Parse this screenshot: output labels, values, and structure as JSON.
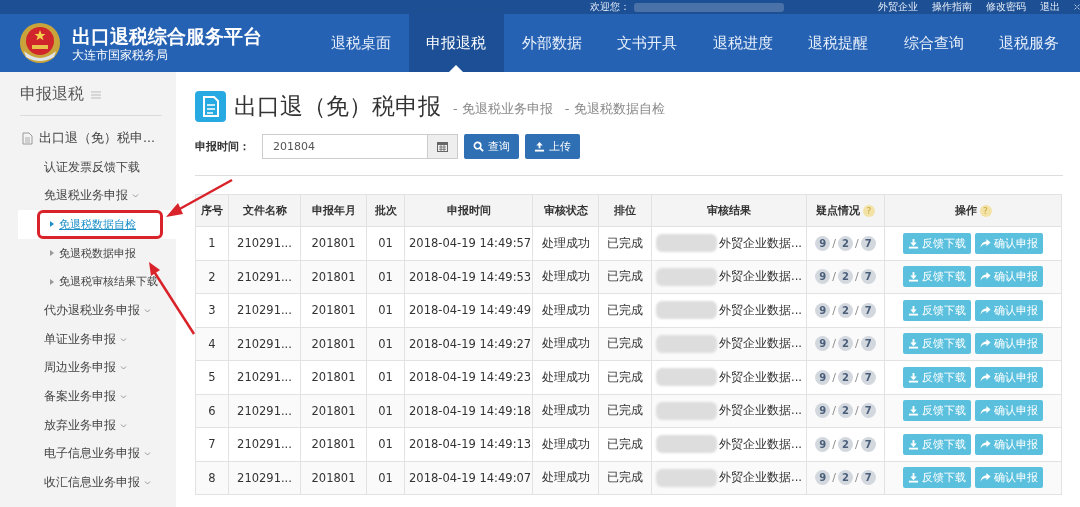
{
  "top_bar": {
    "welcome": "欢迎您：",
    "links": [
      "外贸企业",
      "操作指南",
      "修改密码",
      "退出"
    ]
  },
  "header": {
    "title": "出口退税综合服务平台",
    "subtitle": "大连市国家税务局"
  },
  "nav": [
    {
      "label": "退税桌面",
      "selected": false
    },
    {
      "label": "申报退税",
      "selected": true
    },
    {
      "label": "外部数据",
      "selected": false
    },
    {
      "label": "文书开具",
      "selected": false
    },
    {
      "label": "退税进度",
      "selected": false
    },
    {
      "label": "退税提醒",
      "selected": false
    },
    {
      "label": "综合查询",
      "selected": false
    },
    {
      "label": "退税服务",
      "selected": false
    }
  ],
  "sidebar": {
    "title": "申报退税",
    "items": [
      {
        "kind": "section",
        "label": "出口退（免）税申...",
        "selected": false,
        "children": [
          {
            "kind": "link",
            "label": "认证发票反馈下载",
            "selected": false
          },
          {
            "kind": "menu",
            "label": "免退税业务申报",
            "selected": false,
            "children": [
              {
                "kind": "leaf",
                "label": "免退税数据自检",
                "selected": true,
                "annotated": true
              },
              {
                "kind": "leaf",
                "label": "免退税数据申报",
                "selected": false,
                "annotated": false
              },
              {
                "kind": "leaf",
                "label": "免退税审核结果下载",
                "selected": false,
                "annotated": false
              }
            ]
          },
          {
            "kind": "menu",
            "label": "代办退税业务申报",
            "selected": false
          },
          {
            "kind": "menu",
            "label": "单证业务申报",
            "selected": false
          },
          {
            "kind": "menu",
            "label": "周边业务申报",
            "selected": false
          },
          {
            "kind": "menu",
            "label": "备案业务申报",
            "selected": false
          },
          {
            "kind": "menu",
            "label": "放弃业务申报",
            "selected": false
          },
          {
            "kind": "menu",
            "label": "电子信息业务申报",
            "selected": false
          },
          {
            "kind": "menu",
            "label": "收汇信息业务申报",
            "selected": false
          }
        ]
      }
    ]
  },
  "page": {
    "title": "出口退（免）税申报",
    "breadcrumbs": [
      "- 免退税业务申报",
      "- 免退税数据自检"
    ]
  },
  "search": {
    "label": "申报时间：",
    "value": "201804",
    "buttons": [
      {
        "kind": "search",
        "label": "查询"
      },
      {
        "kind": "upload",
        "label": "上传"
      }
    ]
  },
  "table": {
    "columns": [
      {
        "label": "序号"
      },
      {
        "label": "文件名称"
      },
      {
        "label": "申报年月"
      },
      {
        "label": "批次"
      },
      {
        "label": "申报时间"
      },
      {
        "label": "审核状态"
      },
      {
        "label": "排位"
      },
      {
        "label": "审核结果"
      },
      {
        "label": "疑点情况",
        "help": "?"
      },
      {
        "label": "操作",
        "help": "?"
      }
    ],
    "rows": [
      {
        "no": "1",
        "file": "210291...",
        "month": "201801",
        "batch": "01",
        "time": "2018-04-19 14:49:57",
        "status": "处理成功",
        "rank": "已完成",
        "result": "外贸企业数据...",
        "doubts": [
          {
            "kind": "count",
            "text": "9"
          },
          {
            "kind": "sep",
            "text": "/"
          },
          {
            "kind": "count",
            "text": "2"
          },
          {
            "kind": "sep",
            "text": "/"
          },
          {
            "kind": "count",
            "text": "7"
          }
        ],
        "actions": [
          {
            "kind": "download",
            "label": "反馈下载"
          },
          {
            "kind": "share",
            "label": "确认申报"
          }
        ]
      },
      {
        "no": "2",
        "file": "210291...",
        "month": "201801",
        "batch": "01",
        "time": "2018-04-19 14:49:53",
        "status": "处理成功",
        "rank": "已完成",
        "result": "外贸企业数据...",
        "doubts": [
          {
            "kind": "count",
            "text": "9"
          },
          {
            "kind": "sep",
            "text": "/"
          },
          {
            "kind": "count",
            "text": "2"
          },
          {
            "kind": "sep",
            "text": "/"
          },
          {
            "kind": "count",
            "text": "7"
          }
        ],
        "actions": [
          {
            "kind": "download",
            "label": "反馈下载"
          },
          {
            "kind": "share",
            "label": "确认申报"
          }
        ]
      },
      {
        "no": "3",
        "file": "210291...",
        "month": "201801",
        "batch": "01",
        "time": "2018-04-19 14:49:49",
        "status": "处理成功",
        "rank": "已完成",
        "result": "外贸企业数据...",
        "doubts": [
          {
            "kind": "count",
            "text": "9"
          },
          {
            "kind": "sep",
            "text": "/"
          },
          {
            "kind": "count",
            "text": "2"
          },
          {
            "kind": "sep",
            "text": "/"
          },
          {
            "kind": "count",
            "text": "7"
          }
        ],
        "actions": [
          {
            "kind": "download",
            "label": "反馈下载"
          },
          {
            "kind": "share",
            "label": "确认申报"
          }
        ]
      },
      {
        "no": "4",
        "file": "210291...",
        "month": "201801",
        "batch": "01",
        "time": "2018-04-19 14:49:27",
        "status": "处理成功",
        "rank": "已完成",
        "result": "外贸企业数据...",
        "doubts": [
          {
            "kind": "count",
            "text": "9"
          },
          {
            "kind": "sep",
            "text": "/"
          },
          {
            "kind": "count",
            "text": "2"
          },
          {
            "kind": "sep",
            "text": "/"
          },
          {
            "kind": "count",
            "text": "7"
          }
        ],
        "actions": [
          {
            "kind": "download",
            "label": "反馈下载"
          },
          {
            "kind": "share",
            "label": "确认申报"
          }
        ]
      },
      {
        "no": "5",
        "file": "210291...",
        "month": "201801",
        "batch": "01",
        "time": "2018-04-19 14:49:23",
        "status": "处理成功",
        "rank": "已完成",
        "result": "外贸企业数据...",
        "doubts": [
          {
            "kind": "count",
            "text": "9"
          },
          {
            "kind": "sep",
            "text": "/"
          },
          {
            "kind": "count",
            "text": "2"
          },
          {
            "kind": "sep",
            "text": "/"
          },
          {
            "kind": "count",
            "text": "7"
          }
        ],
        "actions": [
          {
            "kind": "download",
            "label": "反馈下载"
          },
          {
            "kind": "share",
            "label": "确认申报"
          }
        ]
      },
      {
        "no": "6",
        "file": "210291...",
        "month": "201801",
        "batch": "01",
        "time": "2018-04-19 14:49:18",
        "status": "处理成功",
        "rank": "已完成",
        "result": "外贸企业数据...",
        "doubts": [
          {
            "kind": "count",
            "text": "9"
          },
          {
            "kind": "sep",
            "text": "/"
          },
          {
            "kind": "count",
            "text": "2"
          },
          {
            "kind": "sep",
            "text": "/"
          },
          {
            "kind": "count",
            "text": "7"
          }
        ],
        "actions": [
          {
            "kind": "download",
            "label": "反馈下载"
          },
          {
            "kind": "share",
            "label": "确认申报"
          }
        ]
      },
      {
        "no": "7",
        "file": "210291...",
        "month": "201801",
        "batch": "01",
        "time": "2018-04-19 14:49:13",
        "status": "处理成功",
        "rank": "已完成",
        "result": "外贸企业数据...",
        "doubts": [
          {
            "kind": "count",
            "text": "9"
          },
          {
            "kind": "sep",
            "text": "/"
          },
          {
            "kind": "count",
            "text": "2"
          },
          {
            "kind": "sep",
            "text": "/"
          },
          {
            "kind": "count",
            "text": "7"
          }
        ],
        "actions": [
          {
            "kind": "download",
            "label": "反馈下载"
          },
          {
            "kind": "share",
            "label": "确认申报"
          }
        ]
      },
      {
        "no": "8",
        "file": "210291...",
        "month": "201801",
        "batch": "01",
        "time": "2018-04-19 14:49:07",
        "status": "处理成功",
        "rank": "已完成",
        "result": "外贸企业数据...",
        "doubts": [
          {
            "kind": "count",
            "text": "9"
          },
          {
            "kind": "sep",
            "text": "/"
          },
          {
            "kind": "count",
            "text": "2"
          },
          {
            "kind": "sep",
            "text": "/"
          },
          {
            "kind": "count",
            "text": "7"
          }
        ],
        "actions": [
          {
            "kind": "download",
            "label": "反馈下载"
          },
          {
            "kind": "share",
            "label": "确认申报"
          }
        ]
      }
    ]
  }
}
